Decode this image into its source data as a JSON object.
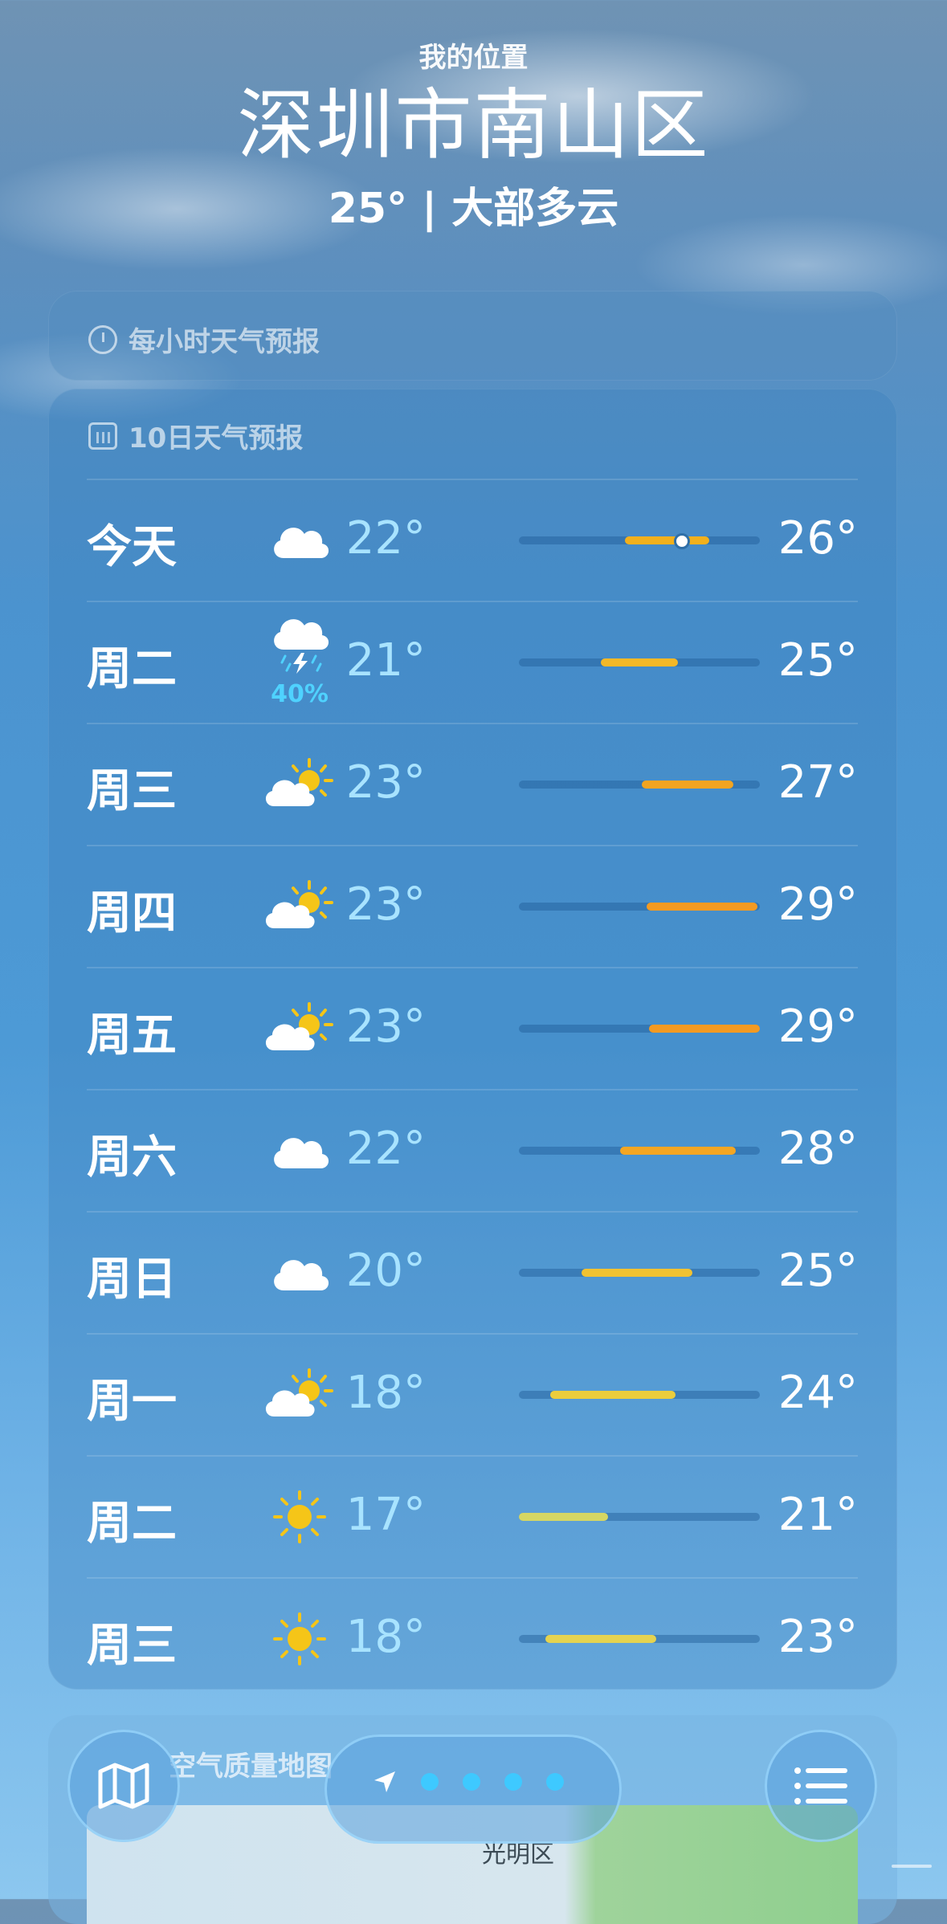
{
  "header": {
    "label": "我的位置",
    "city": "深圳市南山区",
    "summary": "25° | 大部多云"
  },
  "hourly_card": {
    "icon": "clock-icon",
    "title": "每小时天气预报"
  },
  "tenday_card": {
    "icon": "calendar-icon",
    "title": "10日天气预报",
    "days": [
      {
        "name": "今天",
        "icon": "cloud-icon",
        "precip": "",
        "low": "22°",
        "high": "26°",
        "bar_start": 0.44,
        "bar_end": 0.79,
        "bar_color": "#f2b01c",
        "current_marker": 0.67
      },
      {
        "name": "周二",
        "icon": "thunderstorm-icon",
        "precip": "40%",
        "low": "21°",
        "high": "25°",
        "bar_start": 0.34,
        "bar_end": 0.66,
        "bar_color": "#f4b827"
      },
      {
        "name": "周三",
        "icon": "partly-cloudy-icon",
        "precip": "",
        "low": "23°",
        "high": "27°",
        "bar_start": 0.51,
        "bar_end": 0.89,
        "bar_color": "#f2a421"
      },
      {
        "name": "周四",
        "icon": "partly-cloudy-icon",
        "precip": "",
        "low": "23°",
        "high": "29°",
        "bar_start": 0.53,
        "bar_end": 0.99,
        "bar_color": "#f39a22"
      },
      {
        "name": "周五",
        "icon": "partly-cloudy-icon",
        "precip": "",
        "low": "23°",
        "high": "29°",
        "bar_start": 0.54,
        "bar_end": 1.0,
        "bar_color": "#f39a22"
      },
      {
        "name": "周六",
        "icon": "cloud-icon",
        "precip": "",
        "low": "22°",
        "high": "28°",
        "bar_start": 0.42,
        "bar_end": 0.9,
        "bar_color": "#f4a623"
      },
      {
        "name": "周日",
        "icon": "cloud-icon",
        "precip": "",
        "low": "20°",
        "high": "25°",
        "bar_start": 0.26,
        "bar_end": 0.72,
        "bar_color": "#f1c232"
      },
      {
        "name": "周一",
        "icon": "partly-cloudy-icon",
        "precip": "",
        "low": "18°",
        "high": "24°",
        "bar_start": 0.13,
        "bar_end": 0.65,
        "bar_color": "#eccd3c"
      },
      {
        "name": "周二",
        "icon": "sun-icon",
        "precip": "",
        "low": "17°",
        "high": "21°",
        "bar_start": 0.0,
        "bar_end": 0.37,
        "bar_color": "#d6d663"
      },
      {
        "name": "周三",
        "icon": "sun-icon",
        "precip": "",
        "low": "18°",
        "high": "23°",
        "bar_start": 0.11,
        "bar_end": 0.57,
        "bar_color": "#e5d350"
      }
    ]
  },
  "air_quality": {
    "title": "空气质量地图",
    "map_label": "光明区"
  },
  "tab_bar": {
    "map_icon": "map-icon",
    "location_icon": "location-arrow-icon",
    "page_dots": 4,
    "list_icon": "list-icon"
  }
}
